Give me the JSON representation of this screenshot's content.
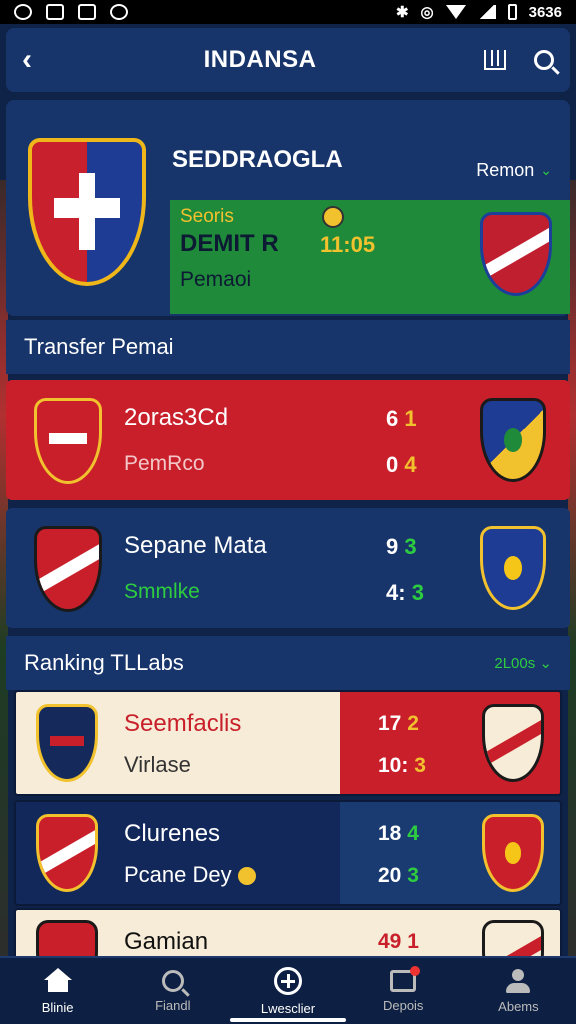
{
  "status_bar": {
    "time": "3636"
  },
  "header": {
    "title": "INDANSA"
  },
  "club": {
    "name": "SEDDRAOGLA",
    "season": "Remon",
    "match": {
      "league": "Seoris",
      "team": "DEMIT R",
      "status": "Pemaoi",
      "time": "11:05"
    }
  },
  "transfer": {
    "title": "Transfer Pemai",
    "rows": [
      {
        "name": "2oras3Cd",
        "sub": "PemRco",
        "score1": [
          "6",
          "1"
        ],
        "score2": [
          "0",
          "4"
        ]
      },
      {
        "name": "Sepane Mata",
        "sub": "Smmlke",
        "score1": [
          "9",
          "3"
        ],
        "score2": [
          "4:",
          "3"
        ]
      }
    ]
  },
  "ranking": {
    "title": "Ranking TLLabs",
    "filter": "2L00s",
    "rows": [
      {
        "name": "Seemfaclis",
        "sub": "Virlase",
        "score1": [
          "17",
          "2"
        ],
        "score2": [
          "10:",
          "3"
        ]
      },
      {
        "name": "Clurenes",
        "sub": "Pcane Dey",
        "score1": [
          "18",
          "4"
        ],
        "score2": [
          "20",
          "3"
        ]
      },
      {
        "name": "Gamian",
        "score1": [
          "49",
          "1"
        ]
      }
    ]
  },
  "bottom_nav": [
    {
      "label": "Blinie",
      "icon": "home-icon"
    },
    {
      "label": "Fiandl",
      "icon": "search-icon"
    },
    {
      "label": "Lwesclier",
      "icon": "compass-icon"
    },
    {
      "label": "Depois",
      "icon": "news-icon"
    },
    {
      "label": "Abems",
      "icon": "profile-icon"
    }
  ],
  "colors": {
    "navy": "#17356a",
    "red": "#c81f2a",
    "green": "#1f8a3a",
    "gold": "#f2c12e",
    "accent_green": "#2ecc40",
    "cream": "#f6ecd7"
  }
}
